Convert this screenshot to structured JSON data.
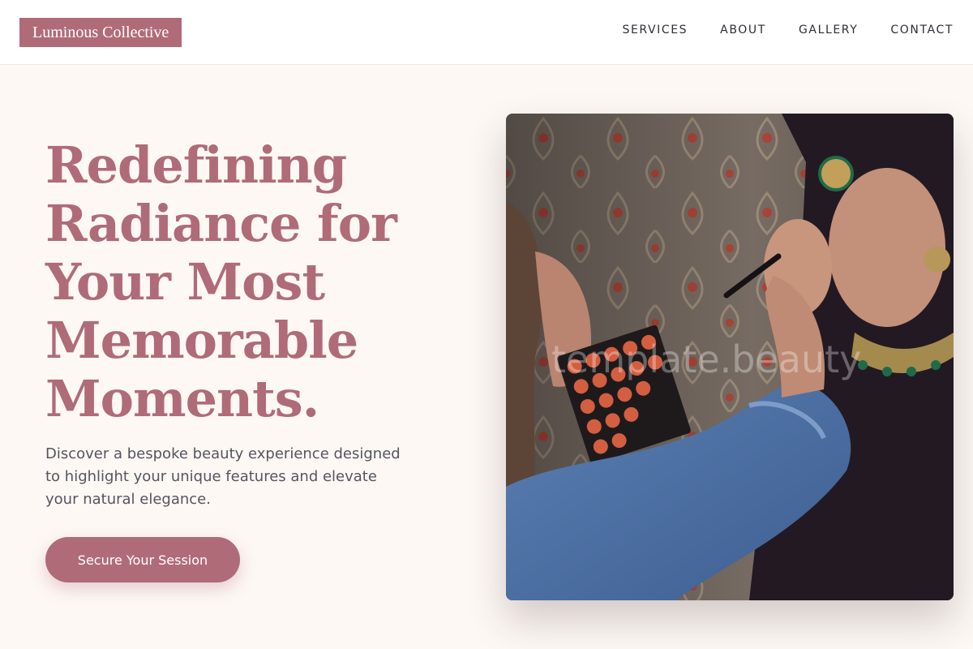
{
  "brand": {
    "name": "Luminous Collective",
    "color": "#b06b78"
  },
  "nav": {
    "items": [
      {
        "label": "SERVICES"
      },
      {
        "label": "ABOUT"
      },
      {
        "label": "GALLERY"
      },
      {
        "label": "CONTACT"
      }
    ]
  },
  "hero": {
    "title_lines": [
      "Redefining",
      "Radiance for",
      "Your Most",
      "Memorable",
      "Moments."
    ],
    "subtitle_lines": [
      "Discover a bespoke beauty experience designed",
      "to highlight your unique features and elevate",
      "your natural elegance."
    ],
    "cta_label": "Secure Your Session"
  },
  "image": {
    "watermark": "template.beauty"
  },
  "colors": {
    "background": "#fdf8f4",
    "accent": "#b06b78",
    "text": "#555560"
  }
}
